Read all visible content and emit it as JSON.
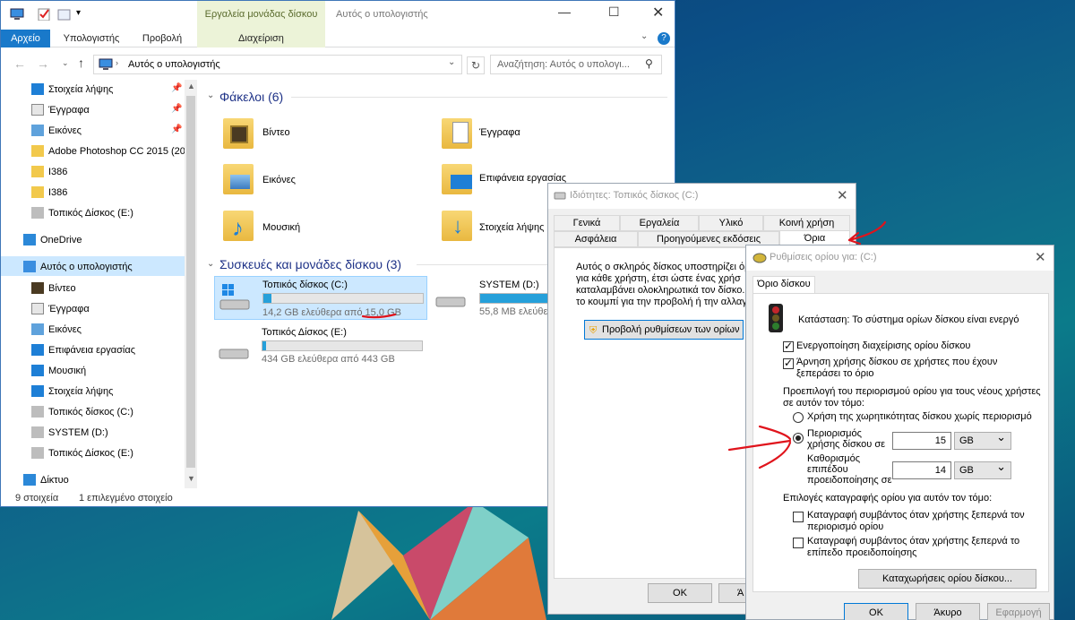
{
  "explorer": {
    "window_title": "Αυτός ο υπολογιστής",
    "tool_group_label": "Εργαλεία μονάδας δίσκου",
    "ribbon_tabs": [
      "Αρχείο",
      "Υπολογιστής",
      "Προβολή",
      "Διαχείριση"
    ],
    "address": "Αυτός ο υπολογιστής",
    "search_placeholder": "Αναζήτηση: Αυτός ο υπολογι...",
    "nav": [
      {
        "label": "Στοιχεία λήψης",
        "icon": "download-icon"
      },
      {
        "label": "Έγγραφα",
        "icon": "document-icon"
      },
      {
        "label": "Εικόνες",
        "icon": "pictures-icon"
      },
      {
        "label": "Adobe Photoshop CC 2015 (20",
        "icon": "folder-icon"
      },
      {
        "label": "I386",
        "icon": "folder-icon"
      },
      {
        "label": "I386",
        "icon": "folder-icon"
      },
      {
        "label": "Τοπικός Δίσκος  (E:)",
        "icon": "drive-icon"
      },
      {
        "label": "OneDrive",
        "icon": "onedrive-icon"
      },
      {
        "label": "Αυτός ο υπολογιστής",
        "icon": "computer-icon"
      },
      {
        "label": "Βίντεο",
        "icon": "video-icon"
      },
      {
        "label": "Έγγραφα",
        "icon": "document-icon"
      },
      {
        "label": "Εικόνες",
        "icon": "pictures-icon"
      },
      {
        "label": "Επιφάνεια εργασίας",
        "icon": "desktop-icon"
      },
      {
        "label": "Μουσική",
        "icon": "music-icon"
      },
      {
        "label": "Στοιχεία λήψης",
        "icon": "download-icon"
      },
      {
        "label": "Τοπικός δίσκος (C:)",
        "icon": "drive-icon"
      },
      {
        "label": "SYSTEM (D:)",
        "icon": "drive-icon"
      },
      {
        "label": "Τοπικός Δίσκος  (E:)",
        "icon": "drive-icon"
      },
      {
        "label": "Δίκτυο",
        "icon": "network-icon"
      }
    ],
    "folders_header": "Φάκελοι (6)",
    "folders": [
      "Βίντεο",
      "Έγγραφα",
      "Εικόνες",
      "Επιφάνεια εργασίας",
      "Μουσική",
      "Στοιχεία λήψης"
    ],
    "devices_header": "Συσκευές και μονάδες δίσκου (3)",
    "drives": [
      {
        "name": "Τοπικός δίσκος (C:)",
        "free": "14,2 GB ελεύθερα από 15,0 GB",
        "used_fraction": 0.05
      },
      {
        "name": "SYSTEM (D:)",
        "free": "55,8 MB ελεύθερα",
        "used_fraction": 0.85
      },
      {
        "name": "Τοπικός Δίσκος  (E:)",
        "free": "434 GB ελεύθερα από 443 GB",
        "used_fraction": 0.02
      }
    ],
    "status_count": "9 στοιχεία",
    "status_selected": "1 επιλεγμένο στοιχείο"
  },
  "props": {
    "title": "Ιδιότητες: Τοπικός δίσκος (C:)",
    "tabs_row1": [
      "Γενικά",
      "Εργαλεία",
      "Υλικό",
      "Κοινή χρήση"
    ],
    "tabs_row2": [
      "Ασφάλεια",
      "Προηγούμενες εκδόσεις",
      "Όρια"
    ],
    "body_lines": [
      "Αυτός ο σκληρός δίσκος υποστηρίζει όρι",
      "για κάθε χρήστη, έτσι ώστε ένας χρήσ",
      "καταλαμβάνει ολοκληρωτικά τον δίσκο.",
      "το κουμπί για την προβολή ή την αλλαγή"
    ],
    "show_settings_button": "Προβολή ρυθμίσεων των ορίων",
    "ok": "OK",
    "cancel_partial": "Ά"
  },
  "quota": {
    "title": "Ρυθμίσεις ορίου για:  (C:)",
    "tab": "Όριο δίσκου",
    "status": "Κατάσταση: Το σύστημα ορίων δίσκου είναι ενεργό",
    "enable_label": "Ενεργοποίηση διαχείρισης ορίου δίσκου",
    "enable_checked": true,
    "deny_label_1": "Άρνηση χρήσης δίσκου σε χρήστες που έχουν",
    "deny_label_2": "ξεπεράσει το όριο",
    "deny_checked": true,
    "default_label_1": "Προεπιλογή του περιορισμού ορίου για τους νέους χρήστες",
    "default_label_2": "σε αυτόν τον τόμο:",
    "no_limit_label": "Χρήση της χωρητικότητας δίσκου χωρίς περιορισμό",
    "limit_label": [
      "Περιορισμός",
      "χρήσης δίσκου σε"
    ],
    "limit_value": "15",
    "limit_unit": "GB",
    "warn_label": [
      "Καθορισμός",
      "επιπέδου",
      "προειδοποίησης σε"
    ],
    "warn_value": "14",
    "warn_unit": "GB",
    "log_header": "Επιλογές καταγραφής ορίου για αυτόν τον τόμο:",
    "log1": [
      "Καταγραφή συμβάντος όταν χρήστης ξεπερνά τον",
      "περιορισμό ορίου"
    ],
    "log2": [
      "Καταγραφή συμβάντος όταν χρήστης ξεπερνά το",
      "επίπεδο προειδοποίησης"
    ],
    "entries_button": "Καταχωρήσεις ορίου δίσκου...",
    "ok": "OK",
    "cancel": "Άκυρο",
    "apply": "Εφαρμογή"
  },
  "colors": {
    "accent": "#1979ca",
    "annotation_red": "#e0141c",
    "bar_fill": "#26a0da"
  }
}
